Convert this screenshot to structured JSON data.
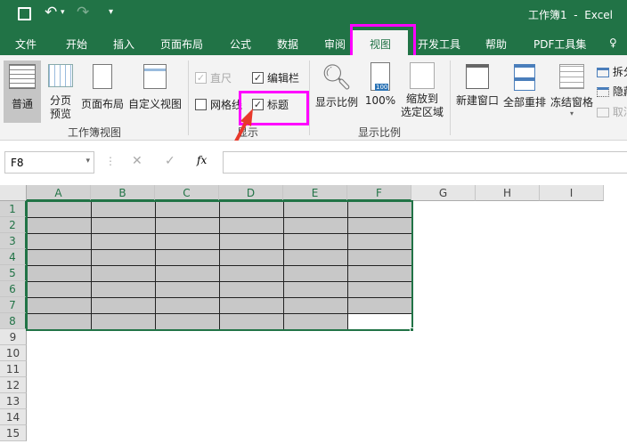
{
  "title": "工作簿1  -  Excel",
  "quick_access": {
    "save": "save-icon",
    "undo": "undo-icon",
    "redo": "redo-icon",
    "customize": "▾"
  },
  "tabs": [
    "文件",
    "开始",
    "插入",
    "页面布局",
    "公式",
    "数据",
    "审阅",
    "视图",
    "开发工具",
    "帮助",
    "PDF工具集"
  ],
  "active_tab": "视图",
  "ribbon": {
    "workbook_views": {
      "label": "工作簿视图",
      "items": [
        "普通",
        "分页\n预览",
        "页面布局",
        "自定义视图"
      ]
    },
    "show": {
      "label": "显示",
      "ruler": "直尺",
      "formula_bar": "编辑栏",
      "gridlines": "网格线",
      "headings": "标题",
      "ruler_checked": true,
      "formula_bar_checked": true,
      "gridlines_checked": false,
      "headings_checked": true
    },
    "zoom": {
      "label": "显示比例",
      "items": [
        "显示比例",
        "100%",
        "缩放到\n选定区域"
      ],
      "badge": "100"
    },
    "window": {
      "items": [
        "新建窗口",
        "全部重排",
        "冻结窗格"
      ],
      "side": [
        "拆分",
        "隐藏",
        "取消"
      ]
    }
  },
  "formula_bar": {
    "name_box": "F8",
    "fx": "fx",
    "value": ""
  },
  "columns": [
    "A",
    "B",
    "C",
    "D",
    "E",
    "F",
    "G",
    "H",
    "I"
  ],
  "rows": [
    "1",
    "2",
    "3",
    "4",
    "5",
    "6",
    "7",
    "8",
    "9",
    "10",
    "11",
    "12",
    "13",
    "14",
    "15"
  ],
  "active_cell": "F8",
  "colors": {
    "accent": "#217346",
    "highlight": "#ff00ff",
    "fill": "#c8c8c8",
    "arrow": "#e8392b"
  }
}
